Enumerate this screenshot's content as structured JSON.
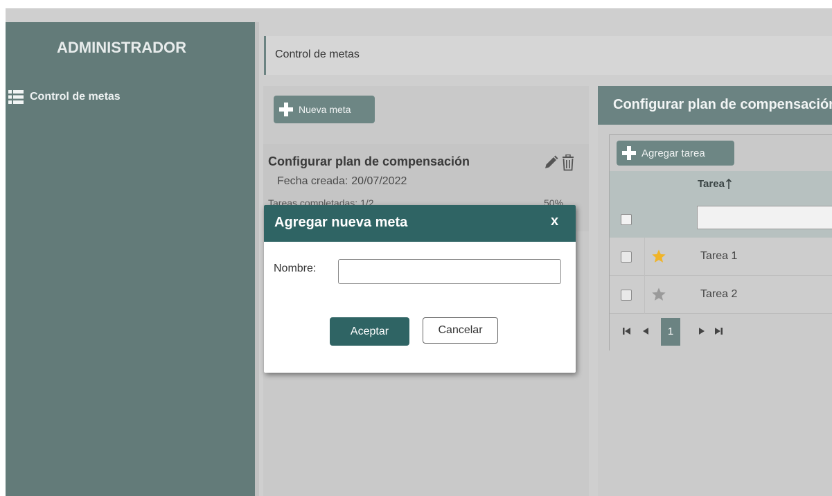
{
  "sidebar": {
    "title": "ADMINISTRADOR",
    "items": [
      {
        "label": "Control de metas",
        "icon": "list-icon"
      }
    ]
  },
  "breadcrumb": {
    "text": "Control de metas"
  },
  "goals_panel": {
    "new_button_label": "Nueva meta",
    "goals": [
      {
        "title": "Configurar plan de compensación",
        "date_label": "Fecha creada:",
        "date_value": "20/07/2022",
        "progress_label": "Tareas completadas: 1/2",
        "progress_percent": "50%"
      }
    ]
  },
  "detail_panel": {
    "title": "Configurar plan de compensación",
    "add_button_label": "Agregar tarea",
    "column_task": "Tarea",
    "tasks": [
      {
        "name": "Tarea 1",
        "starred": true
      },
      {
        "name": "Tarea 2",
        "starred": false
      }
    ],
    "pager": {
      "current_page": "1"
    }
  },
  "dialog": {
    "title": "Agregar nueva meta",
    "close_label": "x",
    "name_label": "Nombre:",
    "name_value": "",
    "accept_label": "Aceptar",
    "cancel_label": "Cancelar"
  },
  "colors": {
    "sidebar_bg": "#637b79",
    "accent": "#6b8382",
    "dialog_header": "#2f6464",
    "star_active": "#f0b429",
    "star_inactive": "#9a9a9a"
  }
}
